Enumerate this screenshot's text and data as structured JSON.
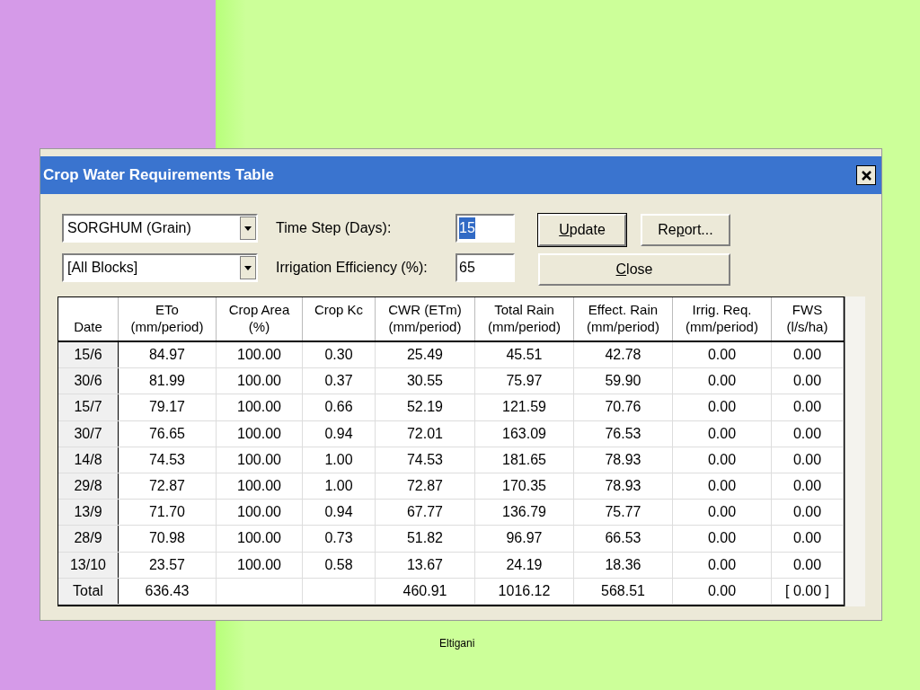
{
  "window": {
    "title": "Crop Water Requirements Table"
  },
  "selects": [
    {
      "value": "SORGHUM (Grain)"
    },
    {
      "value": "[All Blocks]"
    }
  ],
  "fields": [
    {
      "label": "Time Step (Days):",
      "value": "15",
      "text_selected": true
    },
    {
      "label": "Irrigation Efficiency (%):",
      "value": "65",
      "text_selected": false
    }
  ],
  "buttons": [
    {
      "mnemonic": "U",
      "after": "pdate",
      "default": true
    },
    {
      "before": "Re",
      "mnemonic": "p",
      "after": "ort...",
      "default": false
    },
    {
      "mnemonic": "C",
      "after": "lose",
      "default": false
    }
  ],
  "table": {
    "columns": [
      {
        "line_2": "Date"
      },
      {
        "line_1": "ETo",
        "line_2": "(mm/period)"
      },
      {
        "line_1": "Crop Area",
        "line_2": "(%)"
      },
      {
        "line_1": "Crop Kc"
      },
      {
        "line_1": "CWR (ETm)",
        "line_2": "(mm/period)"
      },
      {
        "line_1": "Total Rain",
        "line_2": "(mm/period)"
      },
      {
        "line_1": "Effect. Rain",
        "line_2": "(mm/period)"
      },
      {
        "line_1": "Irrig. Req.",
        "line_2": "(mm/period)"
      },
      {
        "line_1": "FWS",
        "line_2": "(l/s/ha)"
      }
    ],
    "rows": [
      [
        "15/6",
        "84.97",
        "100.00",
        "0.30",
        "25.49",
        "45.51",
        "42.78",
        "0.00",
        "0.00"
      ],
      [
        "30/6",
        "81.99",
        "100.00",
        "0.37",
        "30.55",
        "75.97",
        "59.90",
        "0.00",
        "0.00"
      ],
      [
        "15/7",
        "79.17",
        "100.00",
        "0.66",
        "52.19",
        "121.59",
        "70.76",
        "0.00",
        "0.00"
      ],
      [
        "30/7",
        "76.65",
        "100.00",
        "0.94",
        "72.01",
        "163.09",
        "76.53",
        "0.00",
        "0.00"
      ],
      [
        "14/8",
        "74.53",
        "100.00",
        "1.00",
        "74.53",
        "181.65",
        "78.93",
        "0.00",
        "0.00"
      ],
      [
        "29/8",
        "72.87",
        "100.00",
        "1.00",
        "72.87",
        "170.35",
        "78.93",
        "0.00",
        "0.00"
      ],
      [
        "13/9",
        "71.70",
        "100.00",
        "0.94",
        "67.77",
        "136.79",
        "75.77",
        "0.00",
        "0.00"
      ],
      [
        "28/9",
        "70.98",
        "100.00",
        "0.73",
        "51.82",
        "96.97",
        "66.53",
        "0.00",
        "0.00"
      ],
      [
        "13/10",
        "23.57",
        "100.00",
        "0.58",
        "13.67",
        "24.19",
        "18.36",
        "0.00",
        "0.00"
      ],
      [
        "Total",
        "636.43",
        "",
        "",
        "460.91",
        "1016.12",
        "568.51",
        "0.00",
        "[ 0.00 ]"
      ]
    ]
  },
  "footer": "Eltigani"
}
